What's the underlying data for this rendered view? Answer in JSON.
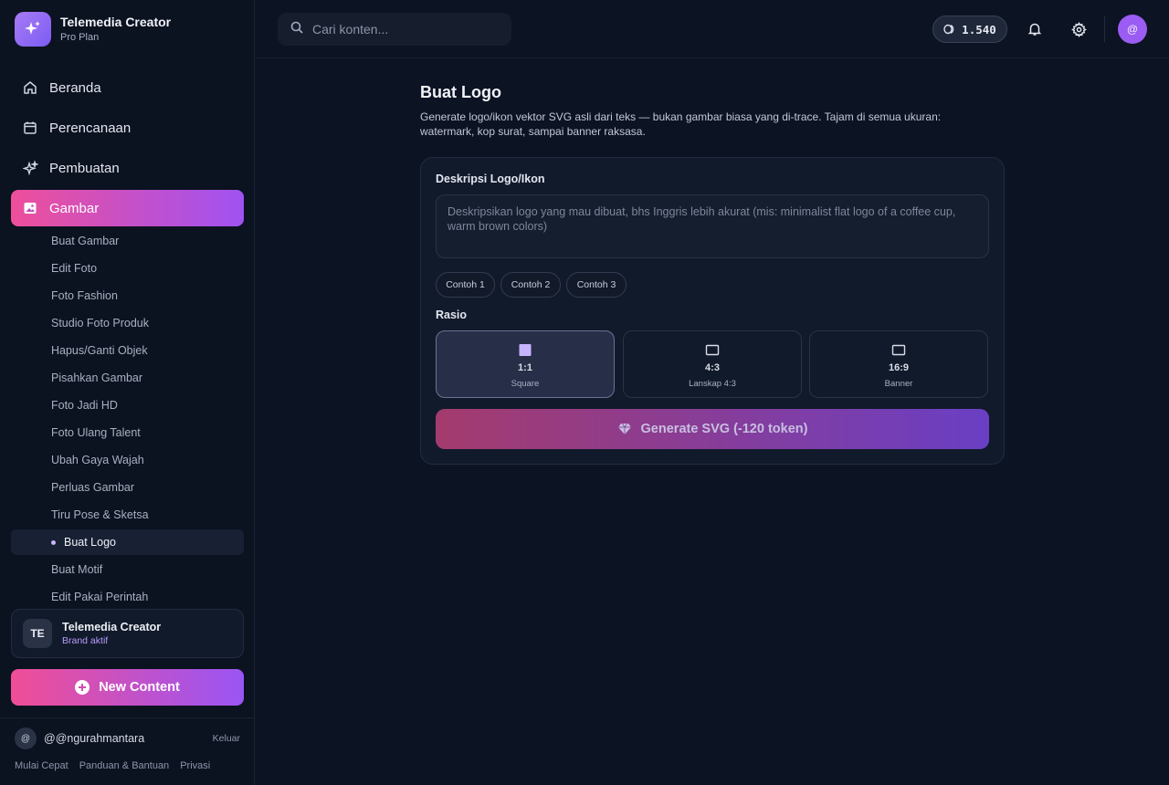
{
  "app": {
    "name": "Telemedia Creator",
    "plan": "Pro Plan"
  },
  "nav": [
    {
      "label": "Beranda",
      "icon": "home-icon"
    },
    {
      "label": "Perencanaan",
      "icon": "calendar-icon"
    },
    {
      "label": "Pembuatan",
      "icon": "sparkles-icon"
    },
    {
      "label": "Gambar",
      "icon": "image-icon",
      "active": true
    }
  ],
  "subnav": [
    "Buat Gambar",
    "Edit Foto",
    "Foto Fashion",
    "Studio Foto Produk",
    "Hapus/Ganti Objek",
    "Pisahkan Gambar",
    "Foto Jadi HD",
    "Foto Ulang Talent",
    "Ubah Gaya Wajah",
    "Perluas Gambar",
    "Tiru Pose & Sketsa",
    "Buat Logo",
    "Buat Motif",
    "Edit Pakai Perintah"
  ],
  "brand_card": {
    "initials": "TE",
    "name": "Telemedia Creator",
    "status": "Brand aktif"
  },
  "new_content": "New Content",
  "user": {
    "avatar": "@",
    "handle": "@@ngurahmantara",
    "logout": "Keluar"
  },
  "footer": [
    "Mulai Cepat",
    "Panduan & Bantuan",
    "Privasi"
  ],
  "topbar": {
    "search_placeholder": "Cari konten...",
    "tokens": "1.540",
    "avatar": "@"
  },
  "page": {
    "title": "Buat Logo",
    "description": "Generate logo/ikon vektor SVG asli dari teks — bukan gambar biasa yang di-trace. Tajam di semua ukuran: watermark, kop surat, sampai banner raksasa."
  },
  "form": {
    "desc_label": "Deskripsi Logo/Ikon",
    "desc_placeholder": "Deskripsikan logo yang mau dibuat, bhs Inggris lebih akurat (mis: minimalist flat logo of a coffee cup, warm brown colors)",
    "examples": [
      "Contoh 1",
      "Contoh 2",
      "Contoh 3"
    ],
    "ratio_label": "Rasio",
    "ratios": [
      {
        "value": "1:1",
        "name": "Square",
        "selected": true
      },
      {
        "value": "4:3",
        "name": "Lanskap 4:3"
      },
      {
        "value": "16:9",
        "name": "Banner"
      }
    ],
    "generate_label": "Generate SVG (-120 token)"
  },
  "colors": {
    "accent_start": "#ee4f9a",
    "accent_end": "#a052f2",
    "background": "#0c1322"
  }
}
